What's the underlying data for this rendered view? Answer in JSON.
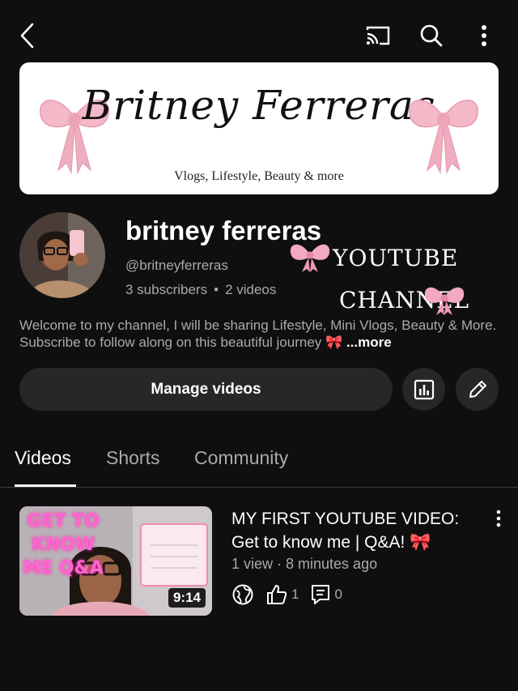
{
  "banner": {
    "script_title": "Britney Ferreras",
    "tagline": "Vlogs, Lifestyle, Beauty & more"
  },
  "channel": {
    "name": "britney ferreras",
    "handle": "@britneyferreras",
    "subscribers": "3 subscribers",
    "separator": "•",
    "videos_count": "2 videos",
    "description": "Welcome to my channel, I will be sharing Lifestyle, Mini Vlogs, Beauty & More. Subscribe to follow along on this beautiful journey 🎀",
    "more_label": "...more",
    "overlay_line1": "YOUTUBE",
    "overlay_line2": "CHANNEL"
  },
  "actions": {
    "manage_label": "Manage videos"
  },
  "tabs": [
    {
      "label": "Videos",
      "active": true
    },
    {
      "label": "Shorts",
      "active": false
    },
    {
      "label": "Community",
      "active": false
    }
  ],
  "video": {
    "title": "MY FIRST YOUTUBE VIDEO: Get to know me | Q&A! 🎀",
    "meta": "1 view · 8 minutes ago",
    "duration": "9:14",
    "thumb_text": "GET TO KNOW ME Q&A",
    "likes": "1",
    "comments": "0"
  },
  "icons": {
    "back": "chevron-left-icon",
    "cast": "cast-icon",
    "search": "search-icon",
    "menu": "more-vert-icon",
    "analytics": "analytics-icon",
    "edit": "pencil-icon",
    "visibility": "globe-icon",
    "like": "thumb-up-icon",
    "comment": "comment-icon"
  },
  "colors": {
    "background": "#0f0f0f",
    "button_bg": "#272727",
    "text_primary": "#f1f1f1",
    "text_secondary": "#aaaaaa",
    "bow_pink": "#f3b9c8"
  }
}
